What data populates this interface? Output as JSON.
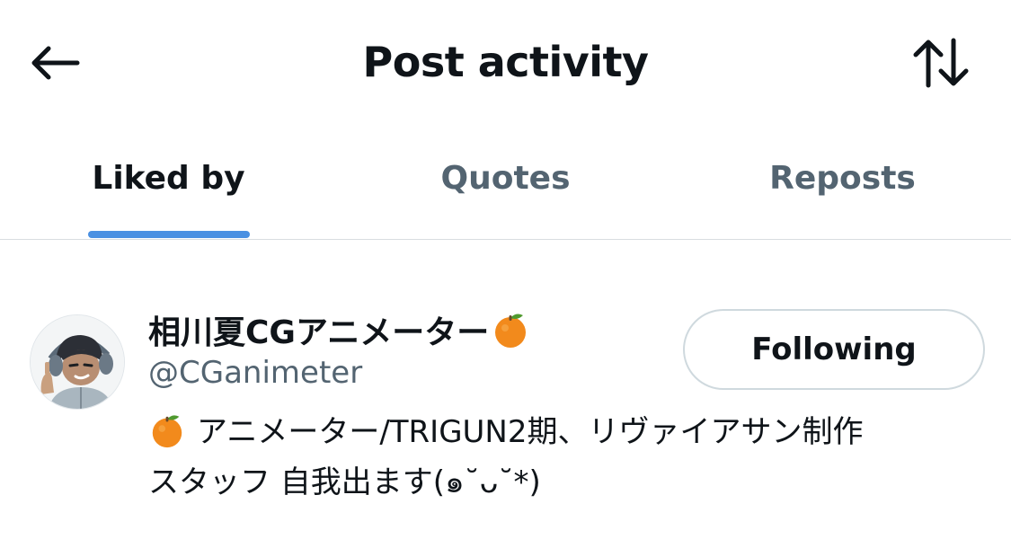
{
  "header": {
    "title": "Post activity",
    "back_icon": "arrow-left-icon",
    "sort_icon": "sort-arrows-icon"
  },
  "tabs": [
    {
      "label": "Liked by",
      "active": true
    },
    {
      "label": "Quotes",
      "active": false
    },
    {
      "label": "Reposts",
      "active": false
    }
  ],
  "user": {
    "display_name": "相川夏CGアニメーター",
    "name_emoji": "orange-emoji",
    "handle": "@CGanimeter",
    "follow_button_label": "Following",
    "bio_emoji": "orange-emoji",
    "bio_line1": "アニメーター/TRIGUN2期、リヴァイアサン制作",
    "bio_line2": "スタッフ 自我出ます(๑˘ᴗ˘*)"
  },
  "colors": {
    "text_primary": "#0f1419",
    "text_secondary": "#536471",
    "accent": "#4a90e2",
    "border": "#cfd9de"
  }
}
